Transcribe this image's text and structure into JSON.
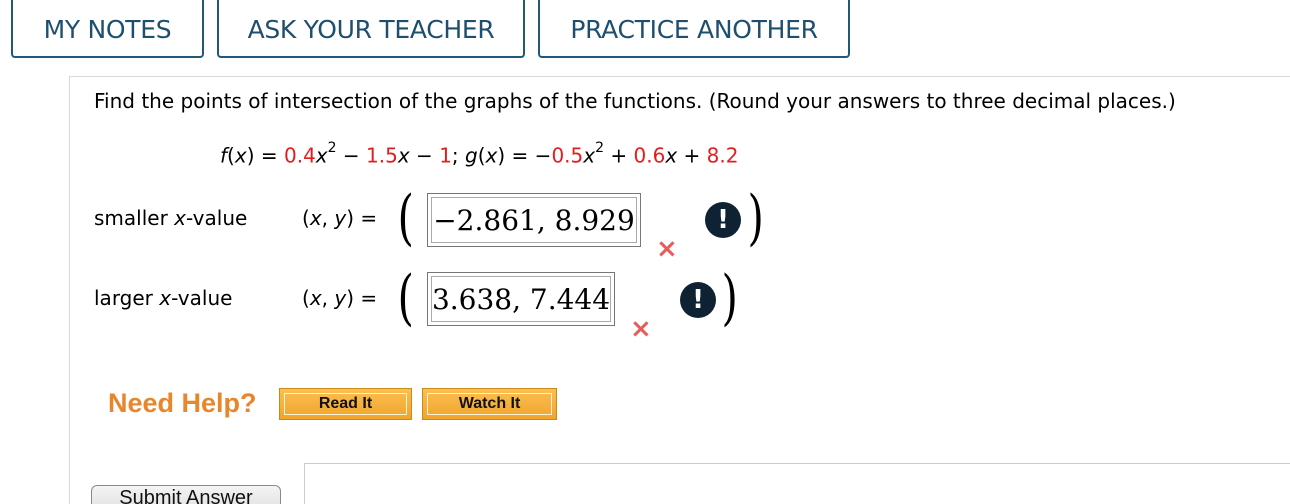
{
  "tabs": {
    "my_notes": "MY NOTES",
    "ask_teacher": "ASK YOUR TEACHER",
    "practice_another": "PRACTICE ANOTHER"
  },
  "question": {
    "prompt": "Find the points of intersection of the graphs of the functions. (Round your answers to three decimal places.)",
    "f": {
      "lhs": "f(x) = ",
      "a": "0.4",
      "x2": "x",
      "exp": "2",
      "op1": " − ",
      "b": "1.5",
      "x1": "x",
      "op2": " − ",
      "c": "1",
      "sep": "; "
    },
    "g": {
      "lhs": "g(x) = −",
      "a": "0.5",
      "x2": "x",
      "exp": "2",
      "op1": " + ",
      "b": "0.6",
      "x1": "x",
      "op2": " + ",
      "c": "8.2"
    }
  },
  "answers": [
    {
      "label_prefix": "smaller ",
      "label_var": "x",
      "label_suffix": "-value",
      "xy_label": "(x, y)  =",
      "value": "−2.861, 8.929",
      "status": "incorrect"
    },
    {
      "label_prefix": "larger ",
      "label_var": "x",
      "label_suffix": "-value",
      "xy_label": "(x, y)  =",
      "value": "3.638, 7.444",
      "status": "incorrect"
    }
  ],
  "help": {
    "title": "Need Help?",
    "read_it": "Read It",
    "watch_it": "Watch It"
  },
  "submit": {
    "label": "Submit Answer"
  },
  "icons": {
    "wrong": "×",
    "alert": "!",
    "open_paren": "(",
    "close_paren": ")"
  },
  "colors": {
    "tab_border": "#1f5a7a",
    "coefficient_red": "#e31d1d",
    "wrong_mark": "#e85b5b",
    "need_help": "#e9862c",
    "help_button": "#f0a42a"
  }
}
